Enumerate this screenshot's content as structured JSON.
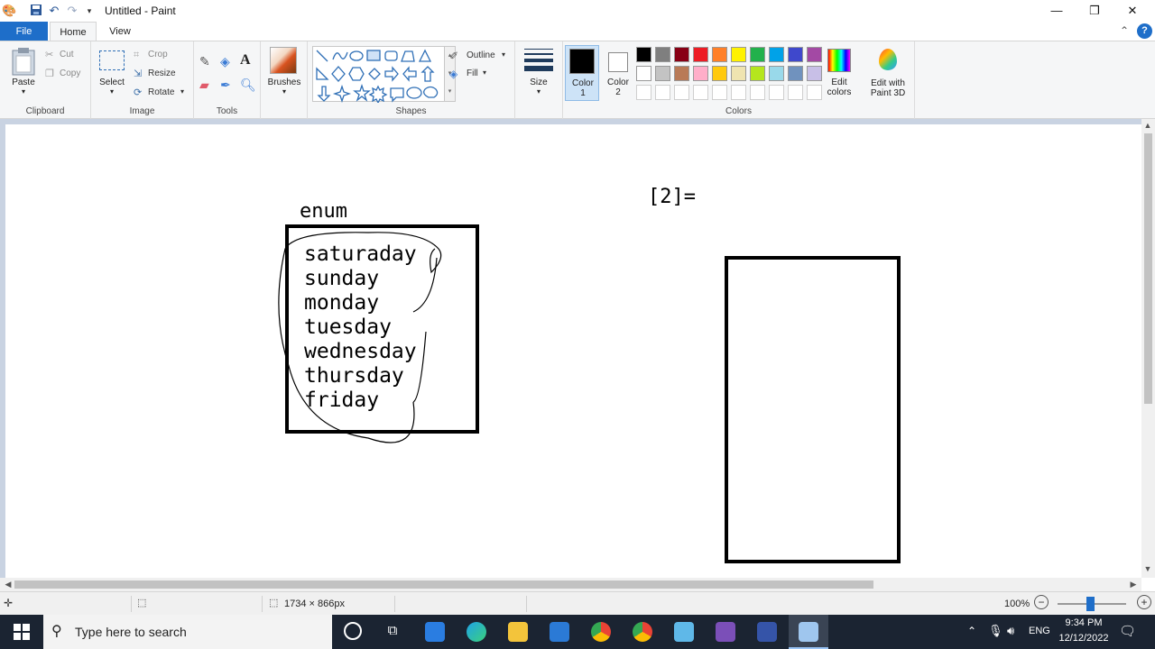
{
  "window": {
    "title": "Untitled - Paint"
  },
  "menu": {
    "file": "File",
    "home": "Home",
    "view": "View"
  },
  "ribbon": {
    "clipboard": {
      "group": "Clipboard",
      "paste": "Paste",
      "cut": "Cut",
      "copy": "Copy"
    },
    "image": {
      "group": "Image",
      "select": "Select",
      "crop": "Crop",
      "resize": "Resize",
      "rotate": "Rotate"
    },
    "tools": {
      "group": "Tools"
    },
    "brushes": {
      "label": "Brushes"
    },
    "shapes": {
      "group": "Shapes",
      "outline": "Outline",
      "fill": "Fill"
    },
    "size": {
      "label": "Size"
    },
    "colors": {
      "group": "Colors",
      "color1_label": "Color",
      "color1_num": "1",
      "color2_label": "Color",
      "color2_num": "2",
      "color1": "#000000",
      "color2": "#ffffff",
      "edit_colors_1": "Edit",
      "edit_colors_2": "colors",
      "palette_row1": [
        "#000000",
        "#7f7f7f",
        "#880015",
        "#ed1c24",
        "#ff7f27",
        "#fff200",
        "#22b14c",
        "#00a2e8",
        "#3f48cc",
        "#a349a4"
      ],
      "palette_row2": [
        "#ffffff",
        "#c3c3c3",
        "#b97a57",
        "#ffaec9",
        "#ffc90e",
        "#efe4b0",
        "#b5e61d",
        "#99d9ea",
        "#7092be",
        "#c8bfe7"
      ]
    },
    "paint3d": {
      "line1": "Edit with",
      "line2": "Paint 3D"
    }
  },
  "canvas": {
    "enum_label": "enum",
    "days": [
      "saturaday",
      "sunday",
      "monday",
      "tuesday",
      "wednesday",
      "thursday",
      "friday"
    ],
    "index_label": "[2]="
  },
  "status": {
    "dimensions": "1734 × 866px",
    "zoom": "100%"
  },
  "taskbar": {
    "search_placeholder": "Type here to search",
    "lang": "ENG",
    "time": "9:34 PM",
    "date": "12/12/2022"
  }
}
